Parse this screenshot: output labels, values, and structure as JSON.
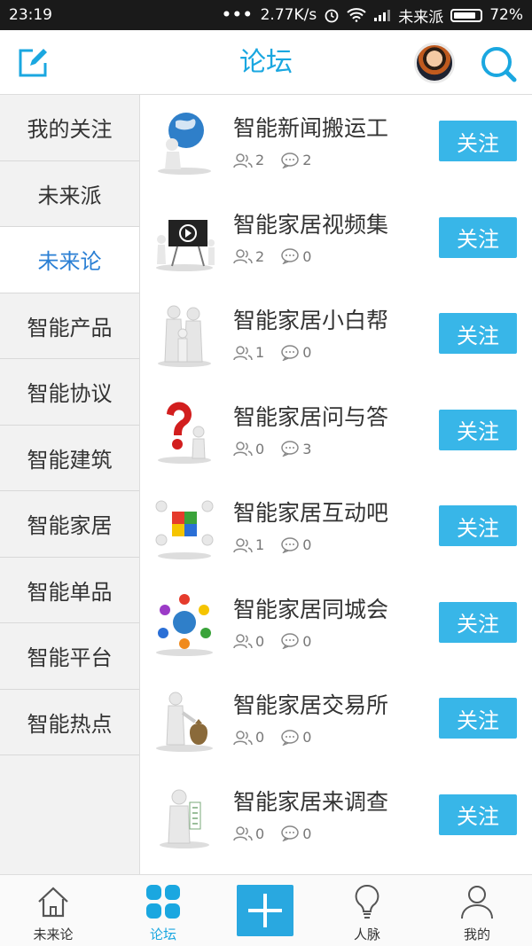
{
  "status_bar": {
    "time": "23:19",
    "dots": "•••",
    "speed": "2.77K/s",
    "carrier": "未来派",
    "battery": "72%"
  },
  "header": {
    "title": "论坛"
  },
  "sidebar": {
    "items": [
      {
        "label": "我的关注"
      },
      {
        "label": "未来派"
      },
      {
        "label": "未来论",
        "active": true
      },
      {
        "label": "智能产品"
      },
      {
        "label": "智能协议"
      },
      {
        "label": "智能建筑"
      },
      {
        "label": "智能家居"
      },
      {
        "label": "智能单品"
      },
      {
        "label": "智能平台"
      },
      {
        "label": "智能热点"
      }
    ]
  },
  "forums": [
    {
      "name": "智能新闻搬运工",
      "members": "2",
      "posts": "2",
      "follow_label": "关注",
      "icon": "globe-figure-icon"
    },
    {
      "name": "智能家居视频集",
      "members": "2",
      "posts": "0",
      "follow_label": "关注",
      "icon": "video-screen-icon"
    },
    {
      "name": "智能家居小白帮",
      "members": "1",
      "posts": "0",
      "follow_label": "关注",
      "icon": "family-figures-icon"
    },
    {
      "name": "智能家居问与答",
      "members": "0",
      "posts": "3",
      "follow_label": "关注",
      "icon": "question-mark-icon"
    },
    {
      "name": "智能家居互动吧",
      "members": "1",
      "posts": "0",
      "follow_label": "关注",
      "icon": "puzzle-figures-icon"
    },
    {
      "name": "智能家居同城会",
      "members": "0",
      "posts": "0",
      "follow_label": "关注",
      "icon": "people-circle-globe-icon"
    },
    {
      "name": "智能家居交易所",
      "members": "0",
      "posts": "0",
      "follow_label": "关注",
      "icon": "money-bag-figure-icon"
    },
    {
      "name": "智能家居来调查",
      "members": "0",
      "posts": "0",
      "follow_label": "关注",
      "icon": "survey-figure-icon"
    }
  ],
  "bottom_nav": [
    {
      "label": "未来论",
      "icon": "house-icon"
    },
    {
      "label": "论坛",
      "icon": "grid-icon",
      "active": true
    },
    {
      "label": "",
      "icon": "plus-icon"
    },
    {
      "label": "人脉",
      "icon": "bulb-icon"
    },
    {
      "label": "我的",
      "icon": "person-icon"
    }
  ],
  "colors": {
    "accent": "#1aa7e0",
    "button": "#38b6e8",
    "sidebar_active_text": "#2a7fd4"
  }
}
